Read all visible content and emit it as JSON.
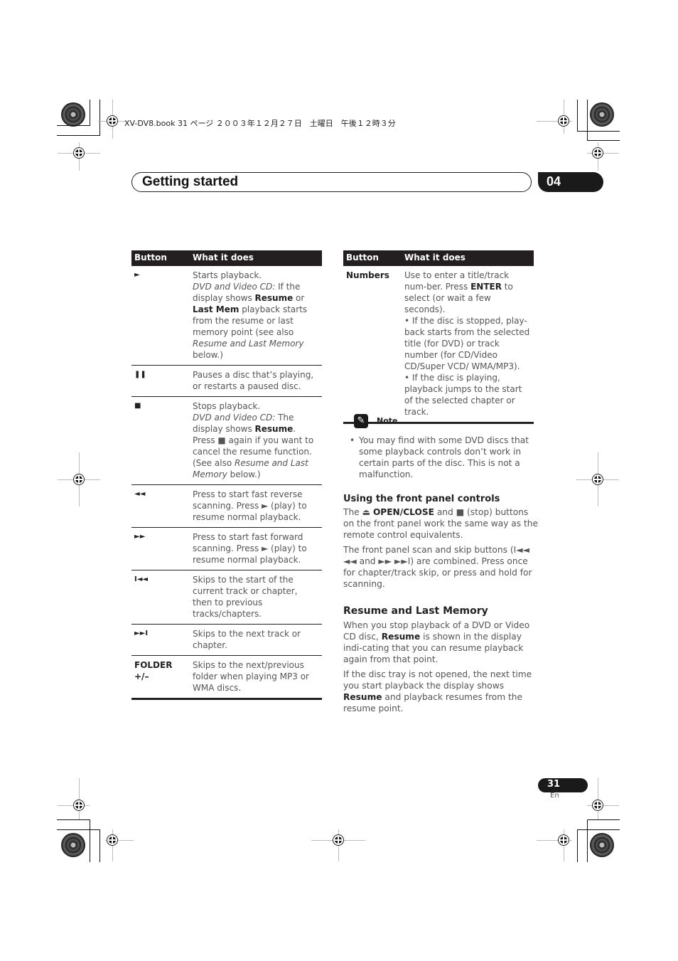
{
  "print_meta": "XV-DV8.book  31 ページ  ２００３年１２月２７日　土曜日　午後１２時３分",
  "header": {
    "title": "Getting started",
    "chapter": "04"
  },
  "left_table": {
    "columns": [
      "Button",
      "What it does"
    ],
    "rows": [
      {
        "button": "►",
        "icon": "play-icon",
        "desc": [
          {
            "t": "Starts playback."
          },
          {
            "br": true
          },
          {
            "t": "DVD and Video CD:",
            "s": "i"
          },
          {
            "t": " If the display shows "
          },
          {
            "t": "Resume",
            "s": "b"
          },
          {
            "t": " or "
          },
          {
            "t": "Last Mem",
            "s": "b"
          },
          {
            "t": " playback starts from the resume or last memory point (see also "
          },
          {
            "t": "Resume and Last Memory",
            "s": "i"
          },
          {
            "t": " below.)"
          }
        ]
      },
      {
        "button": "❚❚",
        "icon": "pause-icon",
        "desc": [
          {
            "t": "Pauses a disc that’s playing, or restarts a paused disc."
          }
        ]
      },
      {
        "button": "■",
        "icon": "stop-icon",
        "desc": [
          {
            "t": "Stops playback."
          },
          {
            "br": true
          },
          {
            "t": "DVD and Video CD:",
            "s": "i"
          },
          {
            "t": " The display shows "
          },
          {
            "t": "Resume",
            "s": "b"
          },
          {
            "t": ". Press ■ again if you want to cancel the resume function. (See also "
          },
          {
            "t": "Resume and Last Memory",
            "s": "i"
          },
          {
            "t": " below.)"
          }
        ]
      },
      {
        "button": "◄◄",
        "icon": "rewind-icon",
        "desc": [
          {
            "t": "Press to start fast reverse scanning. Press ► (play) to resume normal playback."
          }
        ]
      },
      {
        "button": "►►",
        "icon": "fast-forward-icon",
        "desc": [
          {
            "t": "Press to start fast forward scanning. Press ► (play) to resume normal playback."
          }
        ]
      },
      {
        "button": "I◄◄",
        "icon": "skip-previous-icon",
        "desc": [
          {
            "t": "Skips to the start of the current track or chapter, then to previous tracks/chapters."
          }
        ]
      },
      {
        "button": "►►I",
        "icon": "skip-next-icon",
        "desc": [
          {
            "t": "Skips to the next track or chapter."
          }
        ]
      },
      {
        "button": "FOLDER +/–",
        "icon": null,
        "desc": [
          {
            "t": "Skips to the next/previous folder when playing MP3 or WMA discs."
          }
        ]
      }
    ]
  },
  "right_table": {
    "columns": [
      "Button",
      "What it does"
    ],
    "rows": [
      {
        "button": "Numbers",
        "icon": null,
        "desc": [
          {
            "t": "Use to enter a title/track num-ber. Press "
          },
          {
            "t": "ENTER",
            "s": "b"
          },
          {
            "t": " to select (or wait a few seconds)."
          },
          {
            "br": true
          },
          {
            "t": "• If the disc is stopped, play-back starts from the selected title (for DVD) or track number (for CD/Video CD/Super VCD/ WMA/MP3)."
          },
          {
            "br": true
          },
          {
            "t": "• If the disc is playing, playback jumps to the start of the selected chapter or track."
          }
        ]
      }
    ]
  },
  "note": {
    "label": "Note",
    "text": "You may find with some DVD discs that some playback controls don’t work in certain parts of the disc. This is not a malfunction."
  },
  "front_panel": {
    "heading": "Using the front panel controls",
    "p1": [
      {
        "t": "The ⏏ "
      },
      {
        "t": "OPEN/CLOSE",
        "s": "b"
      },
      {
        "t": " and ■ (stop) buttons on the front panel work the same way as the remote control equivalents."
      }
    ],
    "p2": [
      {
        "t": "The front panel scan and skip buttons (I◄◄ ◄◄ and ►► ►►I) are combined. Press once for chapter/track skip, or press and hold for scanning."
      }
    ]
  },
  "resume": {
    "heading": "Resume and Last Memory",
    "p1": [
      {
        "t": "When you stop playback of a DVD or Video CD disc, "
      },
      {
        "t": "Resume",
        "s": "b"
      },
      {
        "t": " is shown in the display indi-cating that you can resume playback again from that point."
      }
    ],
    "p2": [
      {
        "t": "If the disc tray is not opened, the next time you start playback the display shows "
      },
      {
        "t": "Resume",
        "s": "b"
      },
      {
        "t": " and playback resumes from the resume point."
      }
    ]
  },
  "footer": {
    "page": "31",
    "lang": "En"
  }
}
